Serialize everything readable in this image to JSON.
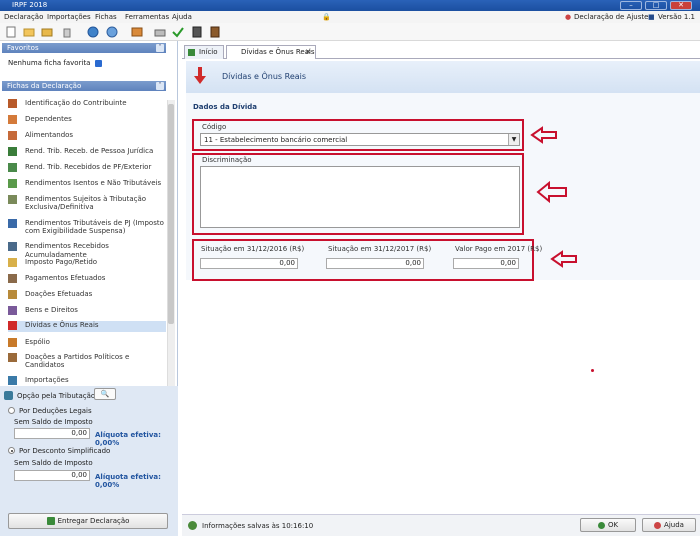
{
  "window": {
    "title": "IRPF 2018"
  },
  "menu": {
    "items": [
      "Declaração",
      "Importações",
      "Fichas",
      "Ferramentas",
      "Ajuda"
    ],
    "right_help": "Declaração de Ajuste",
    "right_version": "Versão 1.1"
  },
  "left": {
    "favorites_header": "Favoritos",
    "favorites_empty": "Nenhuma ficha favorita",
    "fichas_header": "Fichas da Declaração",
    "nav_items": [
      "Identificação do Contribuinte",
      "Dependentes",
      "Alimentandos",
      "Rend. Trib. Receb. de Pessoa Jurídica",
      "Rend. Trib. Recebidos de PF/Exterior",
      "Rendimentos Isentos e Não Tributáveis",
      "Rendimentos Sujeitos à Tributação Exclusiva/Definitiva",
      "Rendimentos Tributáveis de PJ (Imposto com Exigibilidade Suspensa)",
      "Rendimentos Recebidos Acumuladamente",
      "Imposto Pago/Retido",
      "Pagamentos Efetuados",
      "Doações Efetuadas",
      "Bens e Direitos",
      "Dívidas e Ônus Reais",
      "Espólio",
      "Doações a Partidos Políticos e Candidatos",
      "Importações"
    ],
    "option": {
      "title": "Opção pela Tributação:",
      "legal_label": "Por Deduções Legais",
      "legal_balance_label": "Sem Saldo de Imposto",
      "legal_value": "0,00",
      "legal_rate": "Alíquota efetiva: 0,00%",
      "simplified_label": "Por Desconto Simplificado",
      "simplified_balance_label": "Sem Saldo de Imposto",
      "simplified_value": "0,00",
      "simplified_rate": "Alíquota efetiva: 0,00%"
    },
    "deliver_button": "Entregar Declaração"
  },
  "tabs": [
    {
      "label": "Início"
    },
    {
      "label": "Dívidas e Ônus Reais"
    }
  ],
  "form": {
    "title": "Dívidas e Ônus Reais",
    "section": "Dados da Dívida",
    "codigo_label": "Código",
    "codigo_value": "11 - Estabelecimento bancário comercial",
    "discriminacao_label": "Discriminação",
    "sit2016_label": "Situação em 31/12/2016 (R$)",
    "sit2016_value": "0,00",
    "sit2017_label": "Situação em 31/12/2017 (R$)",
    "sit2017_value": "0,00",
    "pago_label": "Valor Pago em 2017 (R$)",
    "pago_value": "0,00"
  },
  "status": {
    "text": "Informações salvas às 10:16:10"
  },
  "buttons": {
    "ok": "OK",
    "help": "Ajuda"
  },
  "colors": {
    "highlight": "#c8102e",
    "header_blue": "#5f83bd",
    "selected_row": "#cfe0f4"
  }
}
